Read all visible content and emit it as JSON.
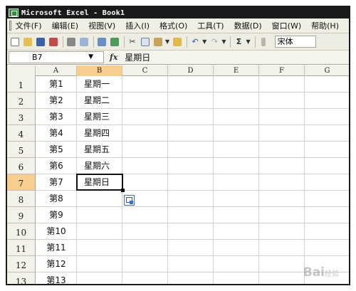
{
  "window": {
    "title": "Microsoft Excel - Book1"
  },
  "menu": [
    "文件(F)",
    "编辑(E)",
    "视图(V)",
    "插入(I)",
    "格式(O)",
    "工具(T)",
    "数据(D)",
    "窗口(W)",
    "帮助(H)"
  ],
  "toolbar": {
    "font_name": "宋体"
  },
  "formula_bar": {
    "name_box": "B7",
    "fx_label": "fx",
    "value": "星期日"
  },
  "sheet": {
    "columns": [
      "A",
      "B",
      "C",
      "D",
      "E",
      "F",
      "G"
    ],
    "selected_column": "B",
    "selected_row": 7,
    "rows": [
      {
        "num": "1",
        "A": "第1",
        "B": "星期一"
      },
      {
        "num": "2",
        "A": "第2",
        "B": "星期二"
      },
      {
        "num": "3",
        "A": "第3",
        "B": "星期三"
      },
      {
        "num": "4",
        "A": "第4",
        "B": "星期四"
      },
      {
        "num": "5",
        "A": "第5",
        "B": "星期五"
      },
      {
        "num": "6",
        "A": "第6",
        "B": "星期六"
      },
      {
        "num": "7",
        "A": "第7",
        "B": "星期日"
      },
      {
        "num": "8",
        "A": "第8",
        "B": ""
      },
      {
        "num": "9",
        "A": "第9",
        "B": ""
      },
      {
        "num": "10",
        "A": "第10",
        "B": ""
      },
      {
        "num": "11",
        "A": "第11",
        "B": ""
      },
      {
        "num": "12",
        "A": "第12",
        "B": ""
      },
      {
        "num": "13",
        "A": "第13",
        "B": ""
      }
    ]
  },
  "watermark": {
    "text": "Bai",
    "suffix": "经验"
  },
  "colors": {
    "title_bar": "#1a1a1a",
    "selection_header": "#f6ce8f",
    "chrome": "#f0efe6"
  }
}
